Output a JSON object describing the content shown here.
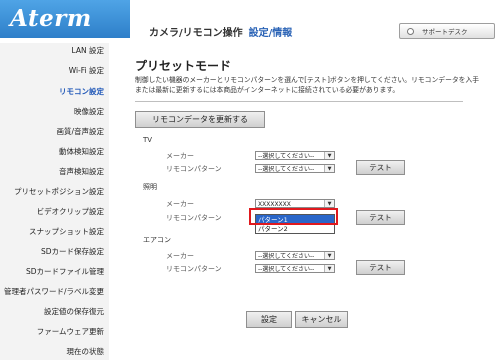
{
  "header": {
    "logo_text": "Aterm",
    "title": "カメラ/リモコン操作",
    "subtitle": "設定/情報",
    "support_label": "サポートデスク"
  },
  "sidebar": {
    "items": [
      {
        "label": "LAN 設定",
        "active": false
      },
      {
        "label": "Wi-Fi 設定",
        "active": false
      },
      {
        "label": "リモコン設定",
        "active": true
      },
      {
        "label": "映像設定",
        "active": false
      },
      {
        "label": "画質/音声設定",
        "active": false
      },
      {
        "label": "動体検知設定",
        "active": false
      },
      {
        "label": "音声検知設定",
        "active": false
      },
      {
        "label": "プリセットポジション設定",
        "active": false
      },
      {
        "label": "ビデオクリップ設定",
        "active": false
      },
      {
        "label": "スナップショット設定",
        "active": false
      },
      {
        "label": "SDカード保存設定",
        "active": false
      },
      {
        "label": "SDカードファイル管理",
        "active": false
      },
      {
        "label": "管理者パスワード/ラベル変更",
        "active": false
      },
      {
        "label": "設定値の保存復元",
        "active": false
      },
      {
        "label": "ファームウェア更新",
        "active": false
      },
      {
        "label": "現在の状態",
        "active": false
      }
    ]
  },
  "main": {
    "title": "プリセットモード",
    "description": "制御したい機器のメーカーとリモコンパターンを選んで[テスト]ボタンを押してください。リモコンデータを入手または最新に更新するには本商品がインターネットに接続されている必要があります。",
    "update_button": "リモコンデータを更新する",
    "sections": [
      {
        "name": "TV",
        "maker_label": "メーカー",
        "maker_value": "--選択してください--",
        "pattern_label": "リモコンパターン",
        "pattern_value": "--選択してください--",
        "test_label": "テスト"
      },
      {
        "name": "照明",
        "maker_label": "メーカー",
        "maker_value": "XXXXXXXX",
        "pattern_label": "リモコンパターン",
        "pattern_value": "",
        "test_label": "テスト"
      },
      {
        "name": "エアコン",
        "maker_label": "メーカー",
        "maker_value": "--選択してください--",
        "pattern_label": "リモコンパターン",
        "pattern_value": "--選択してください--",
        "test_label": "テスト"
      }
    ],
    "dropdown_options": [
      "パターン1",
      "パターン2"
    ],
    "save_button": "設定",
    "cancel_button": "キャンセル"
  },
  "colors": {
    "brand_blue": "#2e7fc9",
    "active_link": "#1e56b7",
    "highlight": "#e0191e",
    "selected_option": "#2a66c9"
  }
}
